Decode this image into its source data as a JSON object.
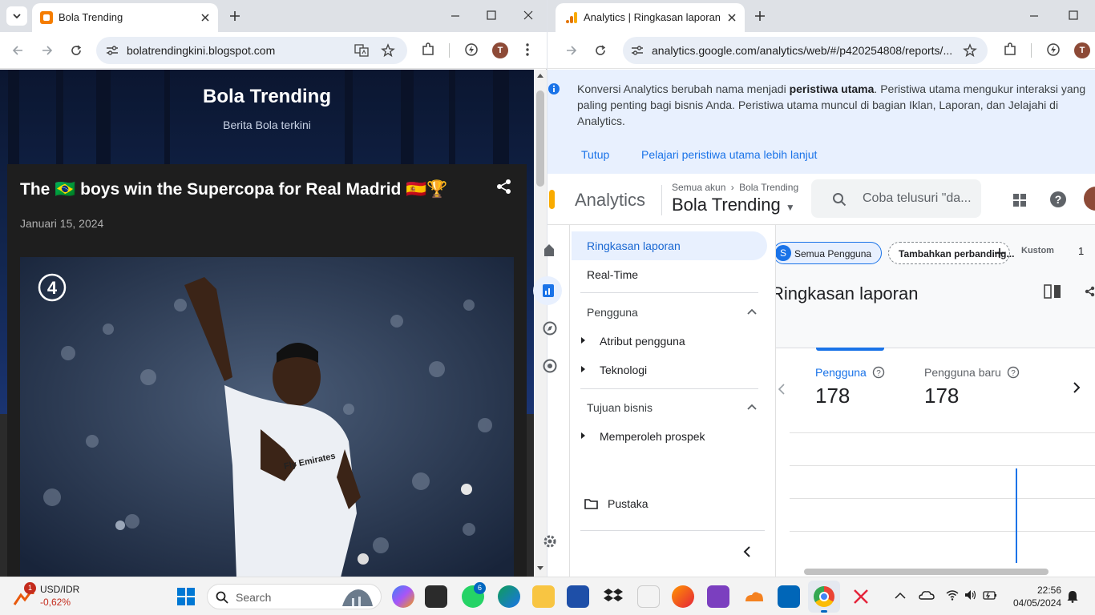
{
  "left_window": {
    "tab_title": "Bola Trending",
    "url": "bolatrendingkini.blogspot.com",
    "avatar_letter": "T",
    "blog": {
      "title": "Bola Trending",
      "subtitle": "Berita Bola terkini",
      "post_title": "The 🇧🇷 boys win the Supercopa for Real Madrid 🇪🇸🏆",
      "post_date": "Januari 15, 2024",
      "image_badge": "4",
      "jersey_text": "Fly Emirates"
    }
  },
  "right_window": {
    "tab_title": "Analytics | Ringkasan laporan",
    "url": "analytics.google.com/analytics/web/#/p420254808/reports/...",
    "avatar_letter": "T",
    "banner": {
      "text_before": "Konversi Analytics berubah nama menjadi ",
      "text_bold": "peristiwa utama",
      "text_after": ". Peristiwa utama mengukur interaksi yang paling penting bagi bisnis Anda. Peristiwa utama muncul di bagian Iklan, Laporan, dan Jelajahi di Analytics.",
      "close_label": "Tutup",
      "learn_label": "Pelajari peristiwa utama lebih lanjut"
    },
    "header": {
      "product": "Analytics",
      "breadcrumb_root": "Semua akun",
      "breadcrumb_account": "Bola Trending",
      "property": "Bola Trending",
      "search_placeholder": "Coba telusuri \"da..."
    },
    "nav": {
      "items": [
        "Ringkasan laporan",
        "Real-Time"
      ],
      "section_users": "Pengguna",
      "users_items": [
        "Atribut pengguna",
        "Teknologi"
      ],
      "section_business": "Tujuan bisnis",
      "business_items": [
        "Memperoleh prospek"
      ],
      "library": "Pustaka"
    },
    "content": {
      "chip_segment_letter": "S",
      "chip_segment": "Semua Pengguna",
      "chip_compare": "Tambahkan perbanding...",
      "date_label": "Kustom",
      "date_partial": "1",
      "report_title": "Ringkasan laporan",
      "metrics": [
        {
          "label": "Pengguna",
          "value": "178"
        },
        {
          "label": "Pengguna baru",
          "value": "178"
        }
      ]
    }
  },
  "taskbar": {
    "stock_name": "USD/IDR",
    "stock_change": "-0,62%",
    "stock_badge": "1",
    "search_label": "Search",
    "whatsapp_badge": "6",
    "time": "22:56",
    "date": "04/05/2024",
    "colors": {
      "negative": "#c42b1c",
      "accent": "#1a73e8"
    }
  }
}
